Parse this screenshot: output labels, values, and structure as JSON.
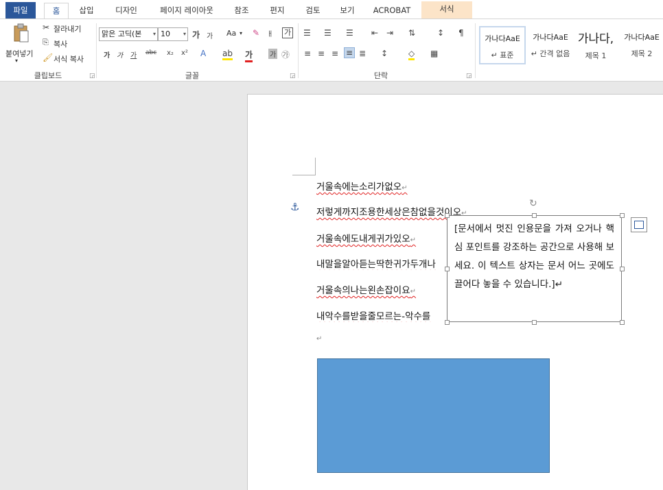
{
  "tabs": [
    {
      "label": "파일"
    },
    {
      "label": "홈"
    },
    {
      "label": "삽입"
    },
    {
      "label": "디자인"
    },
    {
      "label": "페이지 레이아웃"
    },
    {
      "label": "참조"
    },
    {
      "label": "편지"
    },
    {
      "label": "검토"
    },
    {
      "label": "보기"
    },
    {
      "label": "ACROBAT"
    },
    {
      "label": "서식"
    }
  ],
  "clipboard": {
    "paste": "붙여넣기",
    "cut": "잘라내기",
    "copy": "복사",
    "format_painter": "서식 복사",
    "group": "클립보드"
  },
  "font": {
    "name": "맑은 고딕(본",
    "size": "10",
    "change_case": "Aa",
    "group": "글꼴"
  },
  "paragraph": {
    "group": "단락"
  },
  "styles": [
    {
      "sample": "가나다AaE",
      "name": "↵ 표준"
    },
    {
      "sample": "가나다AaE",
      "name": "↵ 간격 없음"
    },
    {
      "sample": "가나다,",
      "name": "제목 1"
    },
    {
      "sample": "가나다AaE",
      "name": "제목 2"
    }
  ],
  "document": {
    "lines": [
      "거울속에는소리가없오",
      "저렇게까지조용한세상은참없을것이오",
      "거울속에도내게귀가있오",
      "내말을알아듣는딱한귀가두개나",
      "거울속의나는왼손잡이요",
      "내악수를받을줄모르는-악수를"
    ],
    "para_mark": "↵",
    "textbox": "[문서에서 멋진 인용문을 가져 오거나 핵심 포인트를 강조하는 공간으로 사용해 보세요. 이 텍스트 상자는 문서 어느 곳에도 끌어다 놓을 수 있습니다.]↵"
  },
  "colors": {
    "file_tab": "#2b579a",
    "context_tab": "#fce4c8",
    "shape_fill": "#5b9bd5",
    "spell_underline": "#e02020"
  }
}
